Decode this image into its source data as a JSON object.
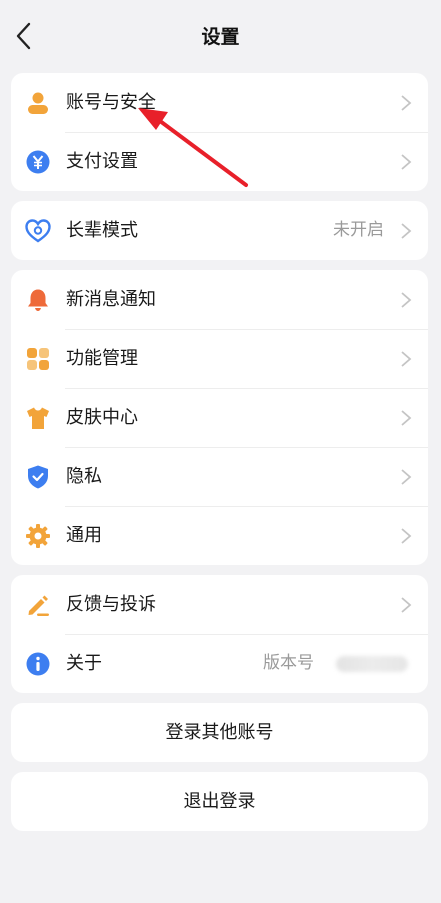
{
  "header": {
    "title": "设置"
  },
  "group1": {
    "account": {
      "label": "账号与安全",
      "icon": "user-icon",
      "color": "#f2a43a"
    },
    "payment": {
      "label": "支付设置",
      "icon": "yen-icon",
      "color": "#3d7ef0"
    }
  },
  "group2": {
    "elder": {
      "label": "长辈模式",
      "value": "未开启",
      "icon": "heart-icon",
      "color": "#3d7ef0"
    }
  },
  "group3": {
    "notify": {
      "label": "新消息通知",
      "icon": "bell-icon",
      "color": "#ee6a3a"
    },
    "features": {
      "label": "功能管理",
      "icon": "grid-icon",
      "color": "#f2a43a"
    },
    "skin": {
      "label": "皮肤中心",
      "icon": "shirt-icon",
      "color": "#f2a43a"
    },
    "privacy": {
      "label": "隐私",
      "icon": "shield-icon",
      "color": "#3d7ef0"
    },
    "general": {
      "label": "通用",
      "icon": "gear-icon",
      "color": "#f2a43a"
    }
  },
  "group4": {
    "feedback": {
      "label": "反馈与投诉",
      "icon": "edit-icon",
      "color": "#f2a43a"
    },
    "about": {
      "label": "关于",
      "value": "版本号",
      "icon": "info-icon",
      "color": "#3d7ef0"
    }
  },
  "buttons": {
    "switch_account": "登录其他账号",
    "logout": "退出登录"
  },
  "annotation": {
    "color": "#e8202a"
  }
}
